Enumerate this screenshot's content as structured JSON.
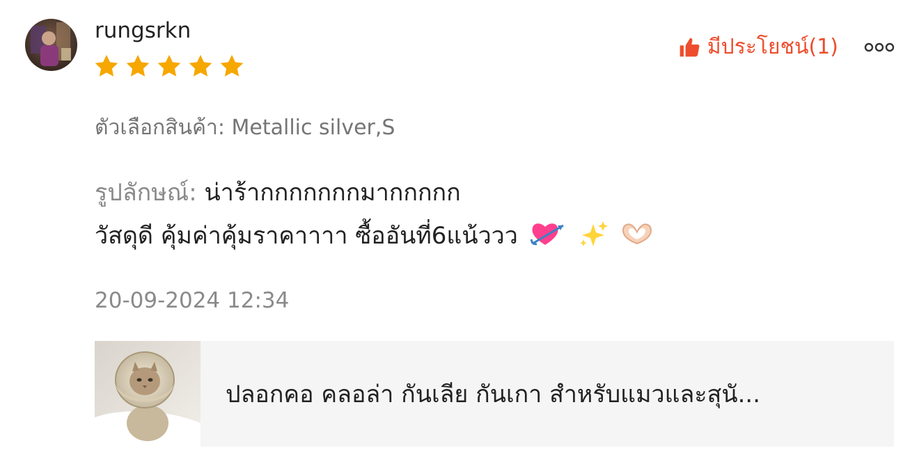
{
  "review": {
    "username": "rungsrkn",
    "rating": 5,
    "star_color": "#f6a700",
    "helpful": {
      "label": "มีประโยชน์(1)",
      "color": "#ee4d2d",
      "icon": "thumbs-up-icon"
    },
    "more_icon": "more-options-icon",
    "variation": "ตัวเลือกสินค้า: Metallic silver,S",
    "appearance_label": "รูปลักษณ์:",
    "appearance_text": "น่าร้ากกกกกกกมากกกกก",
    "body_text": "วัสดุดี คุ้มค่าคุ้มราคาาาา ซื้ออันที่6แน้ววว",
    "emojis": [
      "heart-with-arrow-icon",
      "sparkles-icon",
      "heart-hands-icon"
    ],
    "date": "20-09-2024 12:34"
  },
  "product": {
    "name": "ปลอกคอ คลอล่า กันเลีย กันเกา สำหรับแมวและสุนั...",
    "thumbnail": "cat-with-collar-thumbnail"
  }
}
